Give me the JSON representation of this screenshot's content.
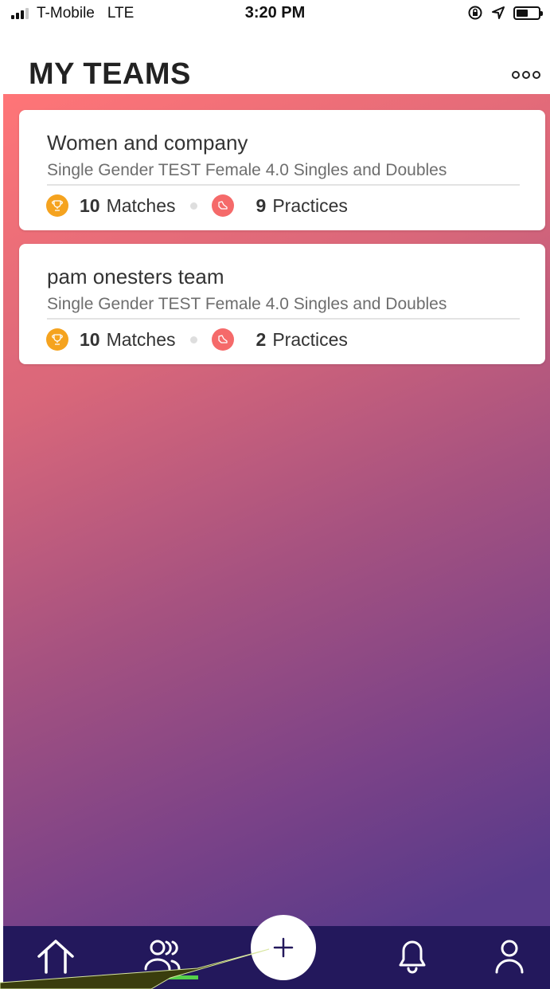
{
  "status_bar": {
    "carrier": "T-Mobile",
    "network": "LTE",
    "time": "3:20 PM"
  },
  "header": {
    "title": "MY TEAMS",
    "more_icon": "more-dots-icon"
  },
  "teams": [
    {
      "name": "Women and company",
      "description": "Single Gender TEST Female 4.0 Singles and Doubles",
      "matches_count": "10",
      "matches_label": "Matches",
      "practices_count": "9",
      "practices_label": "Practices"
    },
    {
      "name": "pam onesters team",
      "description": "Single Gender TEST Female 4.0 Singles and Doubles",
      "matches_count": "10",
      "matches_label": "Matches",
      "practices_count": "2",
      "practices_label": "Practices"
    }
  ],
  "bottom_nav": {
    "items": [
      "home-icon",
      "teams-icon",
      "add-icon",
      "bell-icon",
      "profile-icon"
    ],
    "active": "teams-icon"
  },
  "colors": {
    "gradient_start": "#ff7577",
    "gradient_end": "#583a8a",
    "nav_background": "#23185c",
    "trophy": "#f5a31f",
    "shoe": "#f56a6a",
    "active_indicator": "#55d04a"
  }
}
